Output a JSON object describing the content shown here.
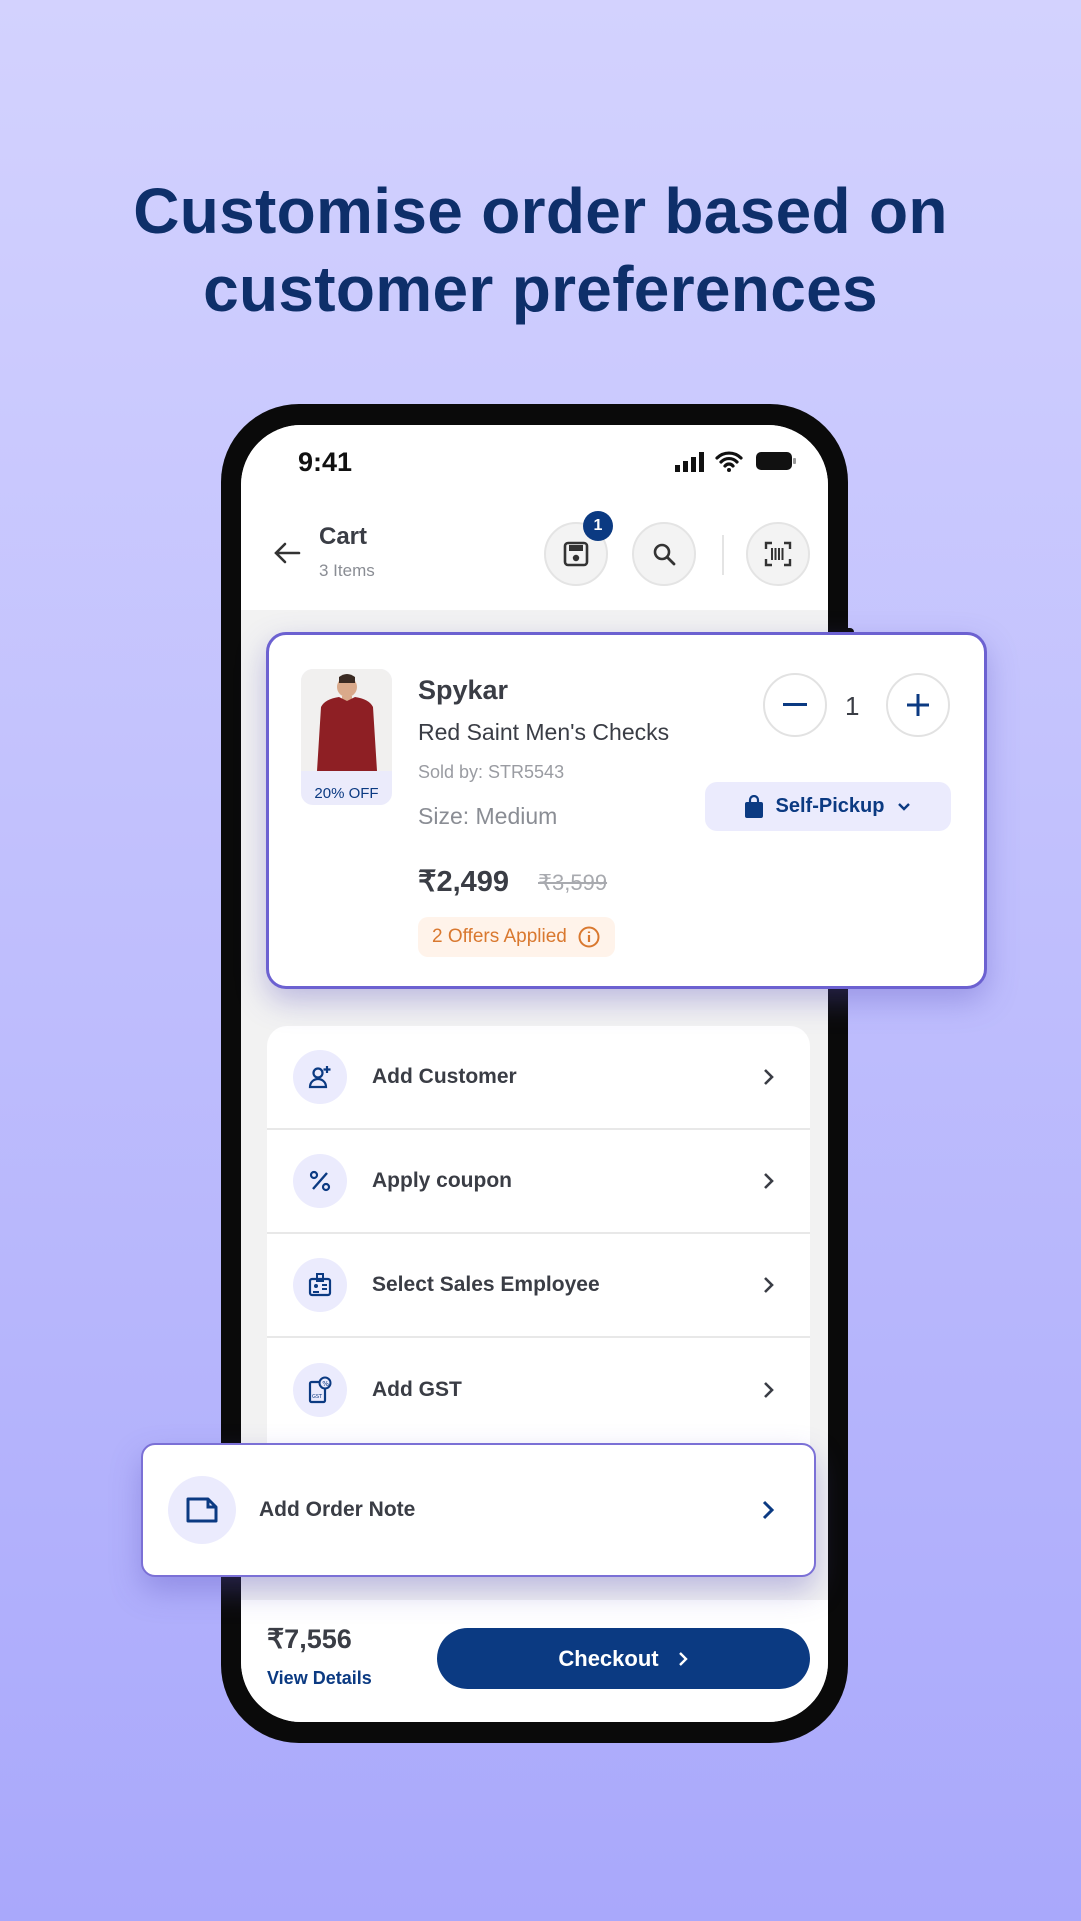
{
  "headline": {
    "line1": "Customise order based on",
    "line2": "customer preferences"
  },
  "status_bar": {
    "time": "9:41",
    "icons": [
      "signal-icon",
      "wifi-icon",
      "battery-icon"
    ]
  },
  "header": {
    "title": "Cart",
    "subtitle": "3 Items",
    "saved_badge": "1",
    "icons": [
      "back-arrow-icon",
      "save-cart-icon",
      "search-icon",
      "barcode-scan-icon"
    ]
  },
  "product": {
    "brand": "Spykar",
    "name": "Red Saint Men's Checks",
    "sold_by": "Sold by: STR5543",
    "size": "Size: Medium",
    "price": "₹2,499",
    "mrp": "₹3,599",
    "discount": "20% OFF",
    "offers": "2 Offers Applied",
    "quantity": "1",
    "delivery_mode": "Self-Pickup"
  },
  "menu": [
    {
      "label": "Add Customer",
      "icon": "add-user-icon"
    },
    {
      "label": "Apply coupon",
      "icon": "percent-icon"
    },
    {
      "label": "Select Sales Employee",
      "icon": "id-badge-icon"
    },
    {
      "label": "Add GST",
      "icon": "gst-document-icon"
    }
  ],
  "order_note": {
    "label": "Add Order Note",
    "icon": "note-icon"
  },
  "footer": {
    "total": "₹7,556",
    "view_details": "View Details",
    "checkout": "Checkout"
  },
  "colors": {
    "brand": "#0b3a82",
    "accent": "#6c61d1",
    "offer": "#d9782f",
    "offer_bg": "#fff3ea",
    "icon_bg": "#ebebfd"
  }
}
